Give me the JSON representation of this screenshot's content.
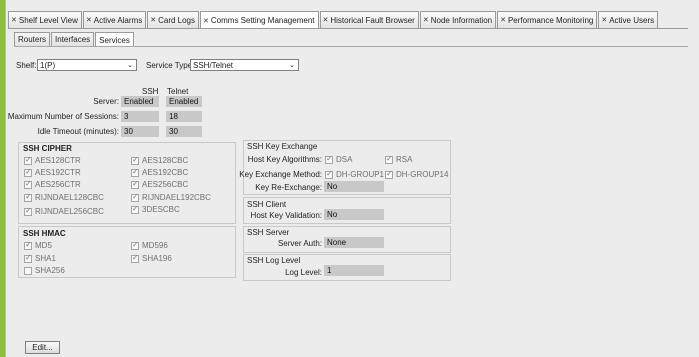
{
  "top_tabs": [
    {
      "label": "Shelf Level View",
      "active": false
    },
    {
      "label": "Active Alarms",
      "active": false
    },
    {
      "label": "Card Logs",
      "active": false
    },
    {
      "label": "Comms Setting Management",
      "active": true
    },
    {
      "label": "Historical Fault Browser",
      "active": false
    },
    {
      "label": "Node Information",
      "active": false
    },
    {
      "label": "Performance Monitoring",
      "active": false
    },
    {
      "label": "Active Users",
      "active": false
    }
  ],
  "sub_tabs": [
    {
      "label": "Routers",
      "active": false
    },
    {
      "label": "Interfaces",
      "active": false
    },
    {
      "label": "Services",
      "active": true
    }
  ],
  "shelf": {
    "label": "Shelf:",
    "value": "1(P)"
  },
  "service_type": {
    "label": "Service Type:",
    "value": "SSH/Telnet"
  },
  "settings": {
    "col_ssh": "SSH",
    "col_telnet": "Telnet",
    "server_label": "Server:",
    "server_ssh": "Enabled",
    "server_telnet": "Enabled",
    "max_sessions_label": "Maximum Number of Sessions:",
    "max_sessions_ssh": "3",
    "max_sessions_telnet": "18",
    "idle_label": "Idle Timeout (minutes):",
    "idle_ssh": "30",
    "idle_telnet": "30"
  },
  "ssh_cipher": {
    "title": "SSH CIPHER",
    "items": [
      {
        "label": "AES128CTR",
        "checked": true
      },
      {
        "label": "AES128CBC",
        "checked": true
      },
      {
        "label": "AES192CTR",
        "checked": true
      },
      {
        "label": "AES192CBC",
        "checked": true
      },
      {
        "label": "AES256CTR",
        "checked": true
      },
      {
        "label": "AES256CBC",
        "checked": true
      },
      {
        "label": "RIJNDAEL128CBC",
        "checked": true
      },
      {
        "label": "RIJNDAEL192CBC",
        "checked": true
      },
      {
        "label": "RIJNDAEL256CBC",
        "checked": true
      },
      {
        "label": "3DESCBC",
        "checked": true
      }
    ]
  },
  "ssh_hmac": {
    "title": "SSH HMAC",
    "items": [
      {
        "label": "MD5",
        "checked": true
      },
      {
        "label": "MD596",
        "checked": true
      },
      {
        "label": "SHA1",
        "checked": true
      },
      {
        "label": "SHA196",
        "checked": true
      },
      {
        "label": "SHA256",
        "checked": false
      }
    ]
  },
  "key_exchange": {
    "title": "SSH Key Exchange",
    "host_key_label": "Host Key Algorithms:",
    "host_key_dsa": "DSA",
    "host_key_rsa": "RSA",
    "method_label": "Key Exchange Method:",
    "method_g1": "DH-GROUP1",
    "method_g14": "DH-GROUP14",
    "rekey_label": "Key Re-Exchange:",
    "rekey_value": "No"
  },
  "ssh_client": {
    "title": "SSH Client",
    "validation_label": "Host Key Validation:",
    "validation_value": "No"
  },
  "ssh_server": {
    "title": "SSH Server",
    "auth_label": "Server Auth:",
    "auth_value": "None"
  },
  "ssh_log": {
    "title": "SSH Log Level",
    "level_label": "Log Level:",
    "level_value": "1"
  },
  "edit_button": "Edit..."
}
